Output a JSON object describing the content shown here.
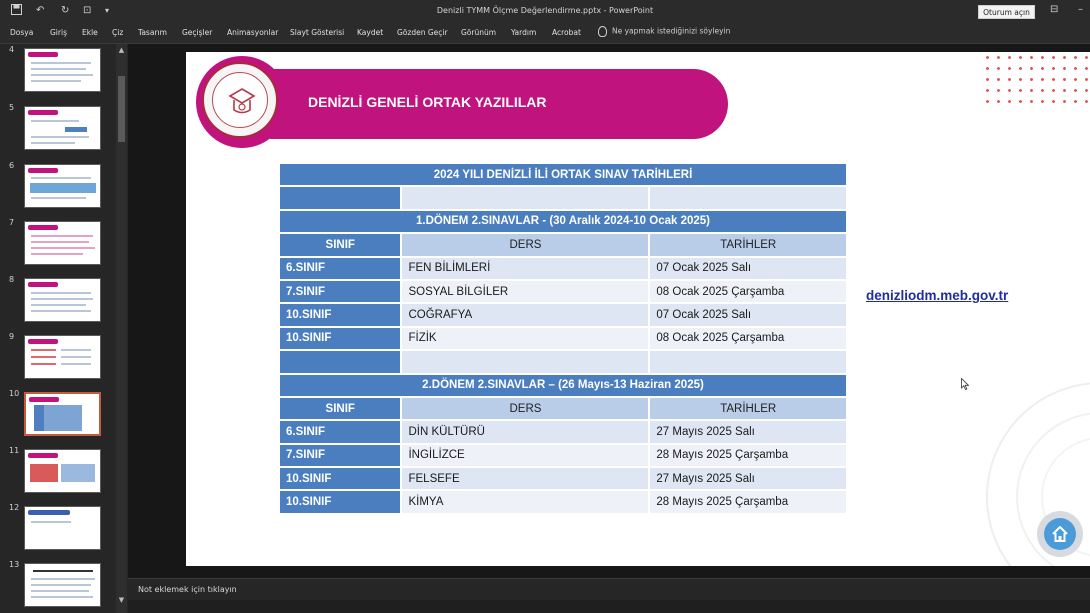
{
  "window": {
    "title": "Denizli TYMM Ölçme Değerlendirme.pptx  -  PowerPoint",
    "signin_label": "Oturum açın"
  },
  "ribbon": {
    "tabs": [
      "Dosya",
      "Giriş",
      "Ekle",
      "Çiz",
      "Tasarım",
      "Geçişler",
      "Animasyonlar",
      "Slayt Gösterisi",
      "Kaydet",
      "Gözden Geçir",
      "Görünüm",
      "Yardım",
      "Acrobat"
    ],
    "tell_me": "Ne yapmak istediğinizi söyleyin"
  },
  "thumbnails": {
    "numbers": [
      "4",
      "5",
      "6",
      "7",
      "8",
      "9",
      "10",
      "11",
      "12",
      "13"
    ],
    "selected": "10"
  },
  "slide": {
    "banner_title": "DENİZLİ GENELİ ORTAK YAZILILAR",
    "link": "denizliodm.meb.gov.tr",
    "table": {
      "title": "2024 YILI DENİZLİ İLİ ORTAK SINAV TARİHLERİ",
      "term1_header": "1.DÖNEM 2.SINAVLAR -   (30 Aralık 2024-10 Ocak 2025)",
      "term2_header": "2.DÖNEM 2.SINAVLAR – (26 Mayıs-13 Haziran 2025)",
      "col_headers": [
        "SINIF",
        "DERS",
        "TARİHLER"
      ],
      "term1_rows": [
        [
          "6.SINIF",
          "FEN BİLİMLERİ",
          "07 Ocak 2025 Salı"
        ],
        [
          "7.SINIF",
          "SOSYAL BİLGİLER",
          "08 Ocak 2025 Çarşamba"
        ],
        [
          "10.SINIF",
          "COĞRAFYA",
          "07 Ocak 2025 Salı"
        ],
        [
          "10.SINIF",
          "FİZİK",
          "08 Ocak 2025 Çarşamba"
        ]
      ],
      "term2_rows": [
        [
          "6.SINIF",
          "DİN KÜLTÜRÜ",
          "27 Mayıs 2025 Salı"
        ],
        [
          "7.SINIF",
          "İNGİLİZCE",
          "28 Mayıs 2025 Çarşamba"
        ],
        [
          "10.SINIF",
          "FELSEFE",
          "27 Mayıs 2025 Salı"
        ],
        [
          "10.SINIF",
          "KİMYA",
          "28 Mayıs 2025 Çarşamba"
        ]
      ]
    }
  },
  "notes": {
    "placeholder": "Not eklemek için tıklayın"
  },
  "colors": {
    "accent_magenta": "#c0137d",
    "table_blue": "#4a7ebf",
    "link_blue": "#1f2e9e"
  }
}
